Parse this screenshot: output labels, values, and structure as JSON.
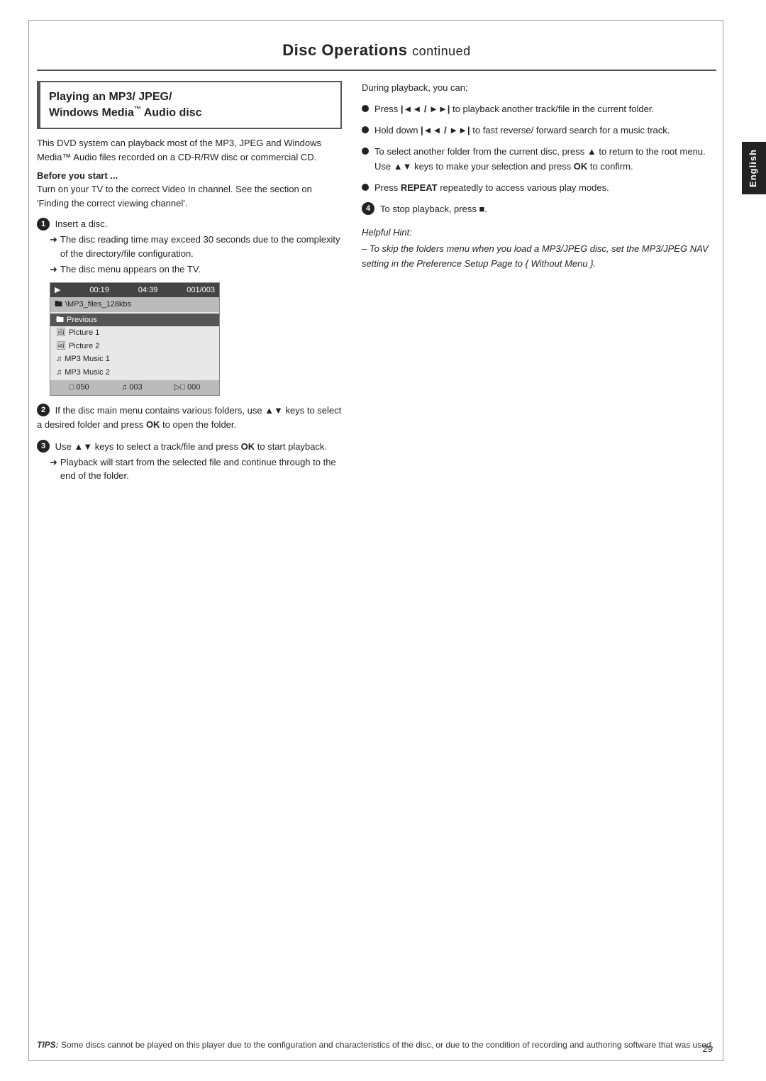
{
  "page": {
    "title": "Disc Operations",
    "title_continued": "continued",
    "page_number": "29"
  },
  "english_tab": "English",
  "left_col": {
    "section_title_line1": "Playing an MP3/ JPEG/",
    "section_title_line2": "Windows Media",
    "section_title_tm": "™",
    "section_title_line3": " Audio disc",
    "intro_text": "This DVD system can playback most of the MP3, JPEG and Windows Media™ Audio files recorded on a CD-R/RW disc or commercial CD.",
    "before_start_label": "Before you start ...",
    "before_start_text": "Turn on your TV to the correct Video In channel.  See the section on 'Finding the correct viewing channel'.",
    "step1_text": "Insert a disc.",
    "step1_arrow1": "The disc reading time may exceed 30 seconds due to the complexity of the directory/file configuration.",
    "step1_arrow2": "The disc menu appears on the TV.",
    "disc_menu": {
      "header_play": "▶",
      "header_time": "00:19",
      "header_total": "04:39",
      "header_track": "001/003",
      "path_icon": "□",
      "path_text": "\\MP3_files_128kbs",
      "items": [
        {
          "icon": "□",
          "label": "Previous",
          "selected": false
        },
        {
          "icon": "□",
          "label": "Picture 1",
          "selected": false
        },
        {
          "icon": "□",
          "label": "Picture 2",
          "selected": false
        },
        {
          "icon": "♫",
          "label": "MP3 Music 1",
          "selected": false
        },
        {
          "icon": "♫",
          "label": "MP3 Music 2",
          "selected": false
        }
      ],
      "footer_pic": "□ 050",
      "footer_music": "♫ 003",
      "footer_vid": "▷□ 000"
    },
    "step2_text": "If the disc main menu contains various folders, use ▲▼ keys to select a desired folder and press",
    "step2_ok": "OK",
    "step2_text2": "to open the folder.",
    "step3_text": "Use ▲▼ keys to select a track/file and press",
    "step3_ok": "OK",
    "step3_text2": "to start playback.",
    "step3_arrow1": "Playback will start from the selected file and continue through to the end of the folder."
  },
  "right_col": {
    "during_text": "During playback, you can;",
    "bullet1": "Press |◄◄ / ►►| to playback another track/file in the current folder.",
    "bullet2": "Hold down |◄◄ / ►►| to fast reverse/ forward search for a music track.",
    "bullet3_pre": "To select another folder from the current disc, press ▲ to return to the root menu. Use ▲▼ keys to make your selection and press",
    "bullet3_ok": "OK",
    "bullet3_post": "to confirm.",
    "bullet4_pre": "Press",
    "bullet4_repeat": "REPEAT",
    "bullet4_post": "repeatedly to access various play modes.",
    "step4_text": "To stop playback, press ■.",
    "helpful_hint_title": "Helpful Hint:",
    "helpful_hint_text": "– To skip the folders menu when you load a MP3/JPEG disc, set the MP3/JPEG NAV setting in the Preference Setup Page to { Without Menu }."
  },
  "tips": {
    "label": "TIPS:",
    "text": "Some discs cannot be played on this player due to the configuration and characteristics of the disc, or due to the condition of recording and authoring software that was used."
  }
}
